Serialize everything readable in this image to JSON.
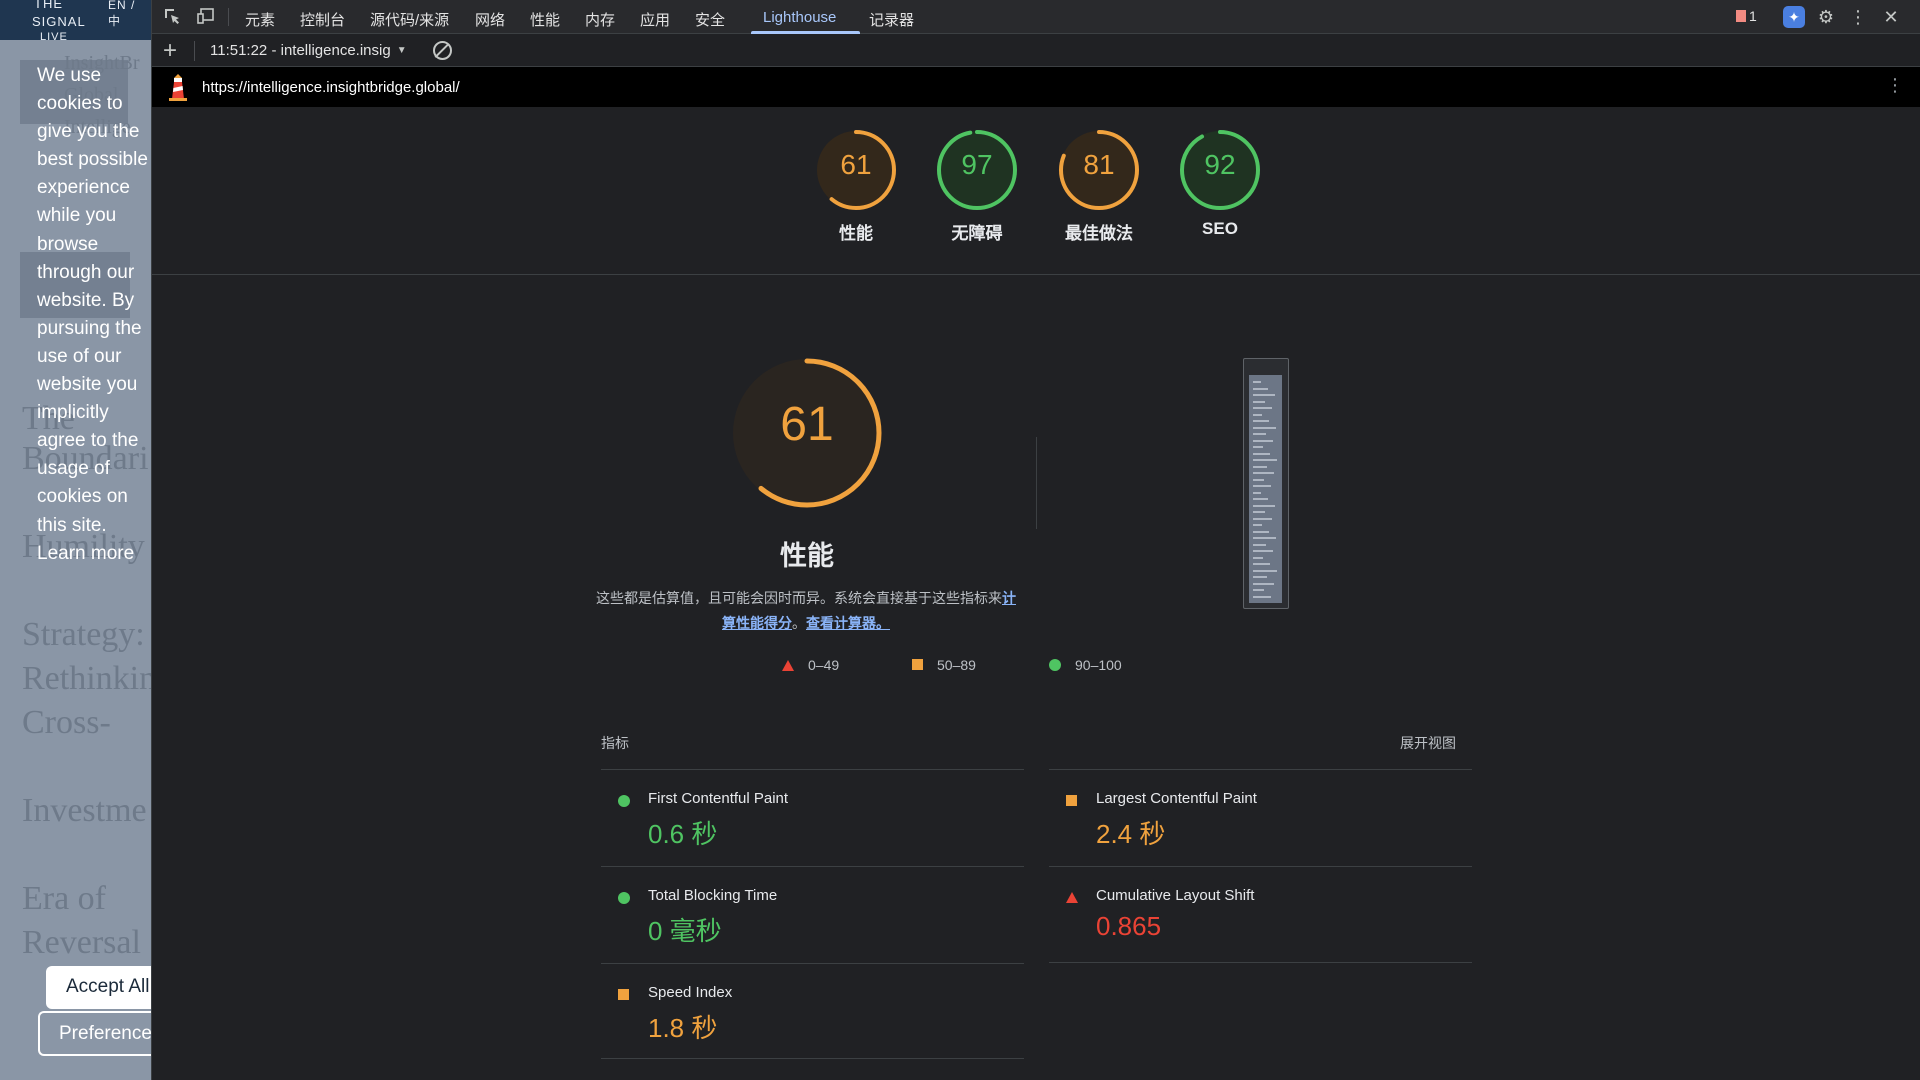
{
  "site": {
    "topbar_left": "THE",
    "topbar_brand": "SIGNAL",
    "topbar_lang": "EN / 中",
    "topbar_live": "LIVE",
    "cookie_text": "We use cookies to give you the best possible experience while you browse through our website. By pursuing the use of our website you implicitly agree to the usage of cookies on this site. Learn more",
    "accept_label": "Accept All",
    "preferences_label": "Preferences"
  },
  "devtools": {
    "tabs": [
      "元素",
      "控制台",
      "源代码/来源",
      "网络",
      "性能",
      "内存",
      "应用",
      "安全",
      "Lighthouse",
      "记录器"
    ],
    "active_tab": "Lighthouse",
    "issues_count": "1",
    "report_label": "11:51:22 - intelligence.insig",
    "url": "https://intelligence.insightbridge.global/"
  },
  "scores": [
    {
      "value": "61",
      "label": "性能",
      "color": "#f0a23e",
      "fraction": 0.61
    },
    {
      "value": "97",
      "label": "无障碍",
      "color": "#4fc462",
      "fraction": 0.97
    },
    {
      "value": "81",
      "label": "最佳做法",
      "color": "#f0a23e",
      "fraction": 0.81
    },
    {
      "value": "92",
      "label": "SEO",
      "color": "#4fc462",
      "fraction": 0.92
    }
  ],
  "performance": {
    "score": "61",
    "fraction": 0.61,
    "title": "性能",
    "desc_part1": "这些都是估算值，且可能会因时而异。系统会直接基于这些指标来",
    "link_calc_score": "计算性能得分",
    "desc_part2": "。",
    "link_calculator": "查看计算器。",
    "legend": [
      {
        "shape": "triangle",
        "range": "0–49",
        "color": "#ea4335"
      },
      {
        "shape": "square",
        "range": "50–89",
        "color": "#f0a23e"
      },
      {
        "shape": "circle",
        "range": "90–100",
        "color": "#4fc462"
      }
    ]
  },
  "metrics": {
    "header": "指标",
    "expand_label": "展开视图",
    "items": [
      {
        "name": "First Contentful Paint",
        "value": "0.6 秒",
        "status": "good"
      },
      {
        "name": "Largest Contentful Paint",
        "value": "2.4 秒",
        "status": "average"
      },
      {
        "name": "Total Blocking Time",
        "value": "0 毫秒",
        "status": "good"
      },
      {
        "name": "Cumulative Layout Shift",
        "value": "0.865",
        "status": "poor"
      },
      {
        "name": "Speed Index",
        "value": "1.8 秒",
        "status": "average"
      }
    ]
  }
}
